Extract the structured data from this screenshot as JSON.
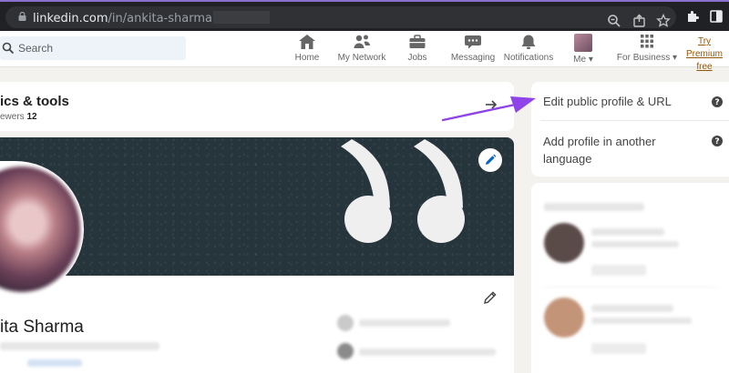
{
  "browser": {
    "url_domain": "linkedin.com",
    "url_path": "/in/ankita-sharma"
  },
  "nav": {
    "search_placeholder": "Search",
    "items": [
      {
        "label": "Home",
        "icon": "home-icon"
      },
      {
        "label": "My Network",
        "icon": "network-icon"
      },
      {
        "label": "Jobs",
        "icon": "briefcase-icon"
      },
      {
        "label": "Messaging",
        "icon": "chat-icon"
      },
      {
        "label": "Notifications",
        "icon": "bell-icon"
      },
      {
        "label": "Me",
        "icon": "avatar"
      },
      {
        "label": "For Business",
        "icon": "grid-icon"
      }
    ],
    "premium_line1": "Try Premium",
    "premium_line2": "free"
  },
  "analytics": {
    "title": "ics & tools",
    "sub_label": "ewers",
    "sub_value": "12"
  },
  "profile": {
    "name": "ita Sharma"
  },
  "right_panel": {
    "edit_public_profile": "Edit public profile & URL",
    "add_language_line1": "Add profile in another",
    "add_language_line2": "language"
  },
  "colors": {
    "annotation_arrow": "#8e44e8",
    "premium_gold": "#915907",
    "banner_bg": "#26343c"
  }
}
